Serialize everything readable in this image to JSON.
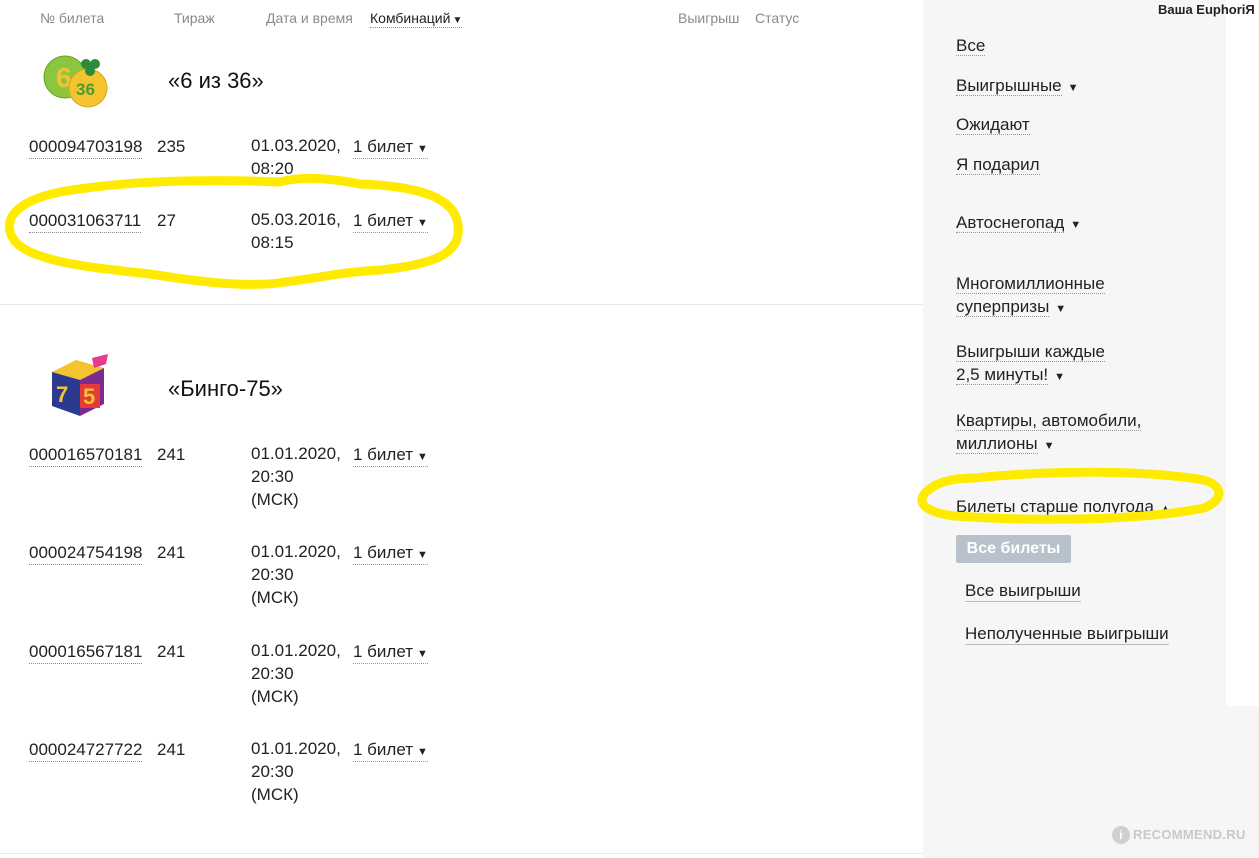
{
  "header": {
    "col_ticket": "№ билета",
    "col_draw": "Тираж",
    "col_datetime": "Дата и время",
    "col_combinations": "Комбинаций",
    "col_win": "Выигрыш",
    "col_status": "Статус",
    "user_greeting": "Ваша EuphoriЯ"
  },
  "lotteries": [
    {
      "title": "«6 из 36»",
      "logo_text": "36",
      "tickets": [
        {
          "number": "000094703198",
          "draw": "235",
          "date": "01.03.2020,",
          "time": "08:20",
          "tz": "",
          "combo": "1 билет"
        },
        {
          "number": "000031063711",
          "draw": "27",
          "date": "05.03.2016,",
          "time": "08:15",
          "tz": "",
          "combo": "1 билет"
        }
      ]
    },
    {
      "title": "«Бинго-75»",
      "logo_text": "75",
      "tickets": [
        {
          "number": "000016570181",
          "draw": "241",
          "date": "01.01.2020,",
          "time": "20:30",
          "tz": "(МСК)",
          "combo": "1 билет"
        },
        {
          "number": "000024754198",
          "draw": "241",
          "date": "01.01.2020,",
          "time": "20:30",
          "tz": "(МСК)",
          "combo": "1 билет"
        },
        {
          "number": "000016567181",
          "draw": "241",
          "date": "01.01.2020,",
          "time": "20:30",
          "tz": "(МСК)",
          "combo": "1 билет"
        },
        {
          "number": "000024727722",
          "draw": "241",
          "date": "01.01.2020,",
          "time": "20:30",
          "tz": "(МСК)",
          "combo": "1 билет"
        }
      ]
    }
  ],
  "sidebar": {
    "filter_all": "Все",
    "filter_winning": "Выигрышные",
    "filter_waiting": "Ожидают",
    "filter_gifted": "Я подарил",
    "autosnow": "Автоснегопад",
    "mega_line1": "Многомиллионные",
    "mega_line2": "суперпризы",
    "every_line1": "Выигрыши каждые",
    "every_line2": "2,5 минуты!",
    "flats_line1": "Квартиры, автомобили,",
    "flats_line2": "миллионы",
    "older": "Билеты старше полугода",
    "all_tickets_btn": "Все билеты",
    "all_wins": "Все выигрыши",
    "unclaimed_wins": "Неполученные выигрыши"
  },
  "watermark": "RECOMMEND.RU",
  "colors": {
    "highlight": "#ffeb00",
    "sidebar_bg": "#f6f6f6",
    "button_bg": "#b7c2cc",
    "logo_green": "#8cc63f",
    "logo_yellow": "#f4c430"
  }
}
